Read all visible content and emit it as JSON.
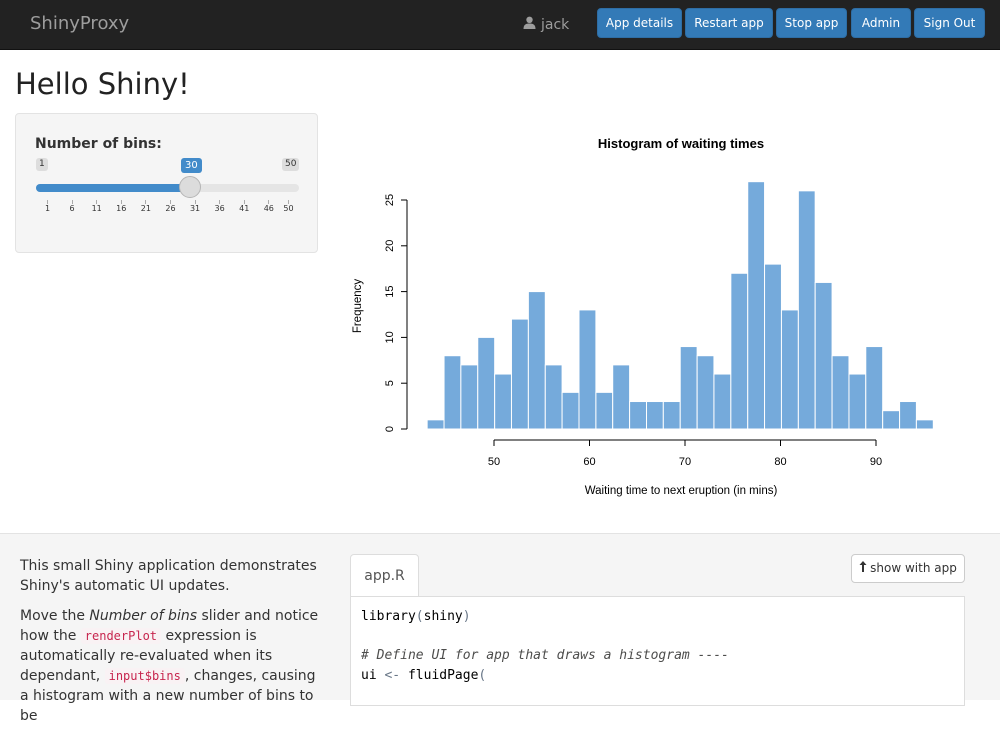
{
  "navbar": {
    "brand": "ShinyProxy",
    "user": "jack",
    "buttons": [
      "App details",
      "Restart app",
      "Stop app",
      "Admin",
      "Sign Out"
    ]
  },
  "page": {
    "title": "Hello Shiny!"
  },
  "slider": {
    "label": "Number of bins:",
    "min": "1",
    "max": "50",
    "value": "30",
    "ticks": [
      "1",
      "6",
      "11",
      "16",
      "21",
      "26",
      "31",
      "36",
      "41",
      "46",
      "50"
    ]
  },
  "chart_data": {
    "type": "bar",
    "title": "Histogram of waiting times",
    "xlabel": "Waiting time to next eruption (in mins)",
    "ylabel": "Frequency",
    "bin_edges": [
      43,
      44.77,
      46.53,
      48.3,
      50.07,
      51.83,
      53.6,
      55.37,
      57.13,
      58.9,
      60.67,
      62.43,
      64.2,
      65.97,
      67.73,
      69.5,
      71.27,
      73.03,
      74.8,
      76.57,
      78.33,
      80.1,
      81.87,
      83.63,
      85.4,
      87.17,
      88.93,
      90.7,
      92.47,
      94.23,
      96
    ],
    "values": [
      1,
      8,
      7,
      10,
      6,
      12,
      15,
      7,
      4,
      13,
      4,
      7,
      3,
      3,
      3,
      9,
      8,
      6,
      17,
      27,
      18,
      13,
      26,
      16,
      8,
      6,
      9,
      2,
      3,
      1
    ],
    "xticks": [
      "50",
      "60",
      "70",
      "80",
      "90"
    ],
    "yticks": [
      "0",
      "5",
      "10",
      "15",
      "20",
      "25"
    ],
    "xlim": [
      43,
      96
    ],
    "ylim": [
      0,
      27
    ],
    "bar_color": "#75aadb"
  },
  "description": {
    "p1": "This small Shiny application demonstrates Shiny's automatic UI updates.",
    "p2_a": "Move the ",
    "p2_em": "Number of bins",
    "p2_b": " slider and notice how the ",
    "p2_code1": "renderPlot",
    "p2_c": " expression is automatically re-evaluated when its dependant, ",
    "p2_code2": "input$bins",
    "p2_d": ", changes, causing a histogram with a new number of bins to be"
  },
  "code_tab": {
    "label": "app.R",
    "show_button": "show with app"
  },
  "code_lines": {
    "l1_fn": "library",
    "l1_arg": "shiny",
    "l2": "# Define UI for app that draws a histogram ----",
    "l3_var": "ui",
    "l3_op": "<-",
    "l3_fn": "fluidPage"
  },
  "colors": {
    "navbar": "#222222",
    "accent": "#337ab7",
    "slider": "#428bca",
    "bars": "#75aadb"
  },
  "icons": {
    "user": "user-icon",
    "show": "arrow-up-icon"
  }
}
